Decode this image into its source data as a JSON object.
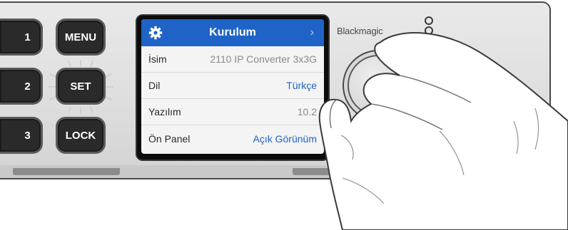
{
  "device": {
    "brand": "Blackmagic",
    "keys": {
      "k1": "1",
      "k2": "2",
      "k3": "3",
      "menu": "MENU",
      "set": "SET",
      "lock": "LOCK"
    }
  },
  "screen": {
    "title": "Kurulum",
    "header_icon": "gear-icon",
    "rows": [
      {
        "label": "İsim",
        "value": "2110 IP Converter 3x3G"
      },
      {
        "label": "Dil",
        "value": "Türkçe"
      },
      {
        "label": "Yazılım",
        "value": "10.2"
      },
      {
        "label": "Ön Panel",
        "value": "Açık Görünüm"
      }
    ]
  },
  "colors": {
    "accent": "#1f63c6",
    "key_bg": "#2a2a2a",
    "panel_bg": "#e2e2e2"
  }
}
